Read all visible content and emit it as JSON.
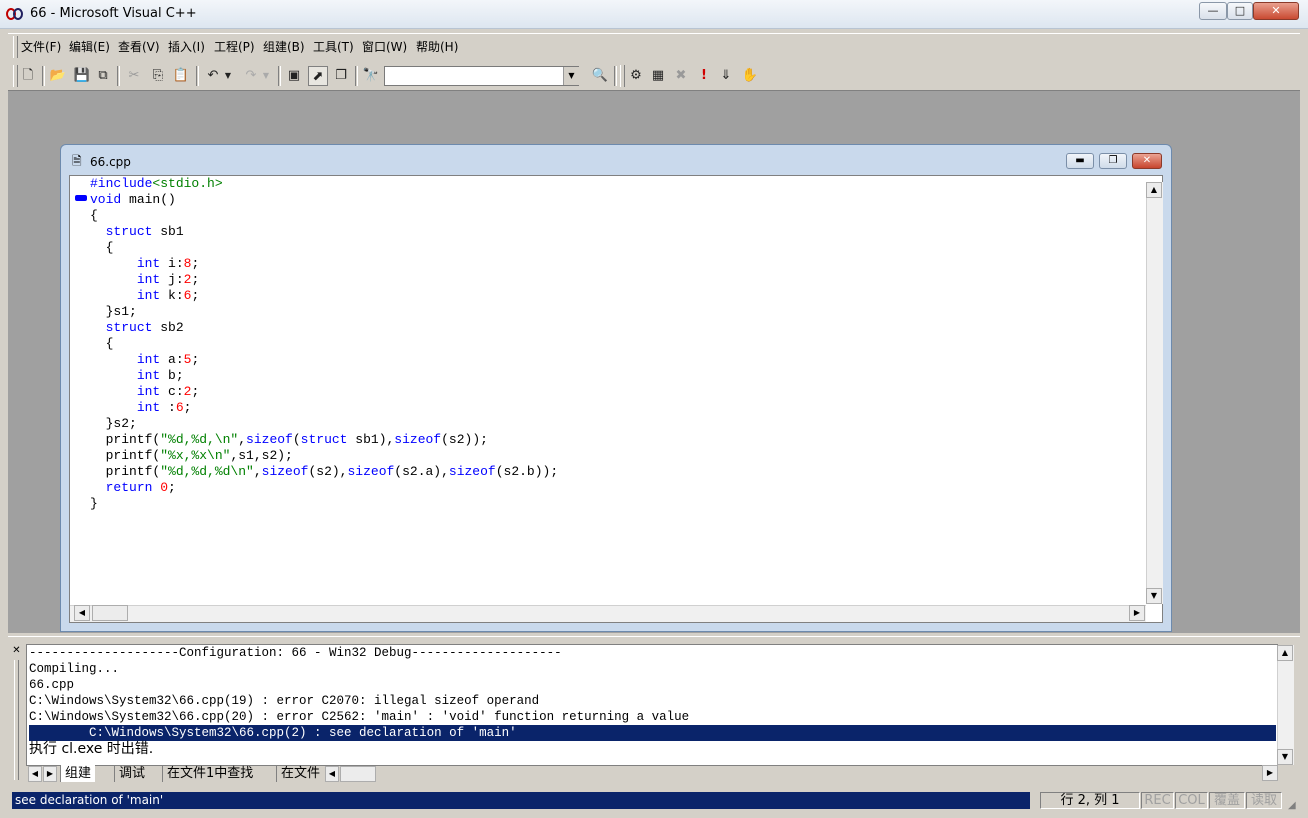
{
  "window": {
    "title": "66 - Microsoft Visual C++",
    "controls": {
      "minimize": "—",
      "maximize": "□",
      "close": "✕"
    }
  },
  "menu": [
    "文件(F)",
    "编辑(E)",
    "查看(V)",
    "插入(I)",
    "工程(P)",
    "组建(B)",
    "工具(T)",
    "窗口(W)",
    "帮助(H)"
  ],
  "toolbar": {
    "icons": [
      "new-file-icon",
      "open-folder-icon",
      "save-icon",
      "save-all-icon",
      "cut-icon",
      "copy-icon",
      "paste-icon",
      "undo-icon",
      "redo-icon",
      "workspace-icon",
      "output-icon",
      "window-list-icon",
      "find-in-files-icon",
      "find-icon",
      "compile-icon",
      "build-icon",
      "stop-build-icon",
      "execute-icon",
      "go-icon",
      "breakpoint-icon"
    ],
    "find_value": ""
  },
  "document": {
    "title": "66.cpp",
    "lines": [
      "#include<stdio.h>",
      "void main()",
      "{",
      "  struct sb1",
      "  {",
      "      int i:8;",
      "      int j:2;",
      "      int k:6;",
      "  }s1;",
      "  struct sb2",
      "  {",
      "      int a:5;",
      "      int b;",
      "      int c:2;",
      "      int :6;",
      "  }s2;",
      "  printf(\"%d,%d,\\n\",sizeof(struct sb1),sizeof(s2));",
      "  printf(\"%x,%x\\n\",s1,s2);",
      "  printf(\"%d,%d,%d\\n\",sizeof(s2),sizeof(s2.a),sizeof(s2.b));",
      "  return 0;",
      "}"
    ]
  },
  "output": {
    "lines": [
      "--------------------Configuration: 66 - Win32 Debug--------------------",
      "Compiling...",
      "66.cpp",
      "C:\\Windows\\System32\\66.cpp(19) : error C2070: illegal sizeof operand",
      "C:\\Windows\\System32\\66.cpp(20) : error C2562: 'main' : 'void' function returning a value",
      "        C:\\Windows\\System32\\66.cpp(2) : see declaration of 'main'",
      "执行 cl.exe 时出错."
    ],
    "highlighted_index": 5,
    "tabs": [
      "组建",
      "调试",
      "在文件1中查找",
      "在文件"
    ]
  },
  "status": {
    "message": "see declaration of 'main'",
    "position": "行 2, 列 1",
    "indicators": [
      "REC",
      "COL",
      "覆盖",
      "读取"
    ]
  },
  "colors": {
    "keyword": "#0000ff",
    "string": "#008000",
    "number": "#ff0000",
    "highlight": "#0a246a"
  }
}
